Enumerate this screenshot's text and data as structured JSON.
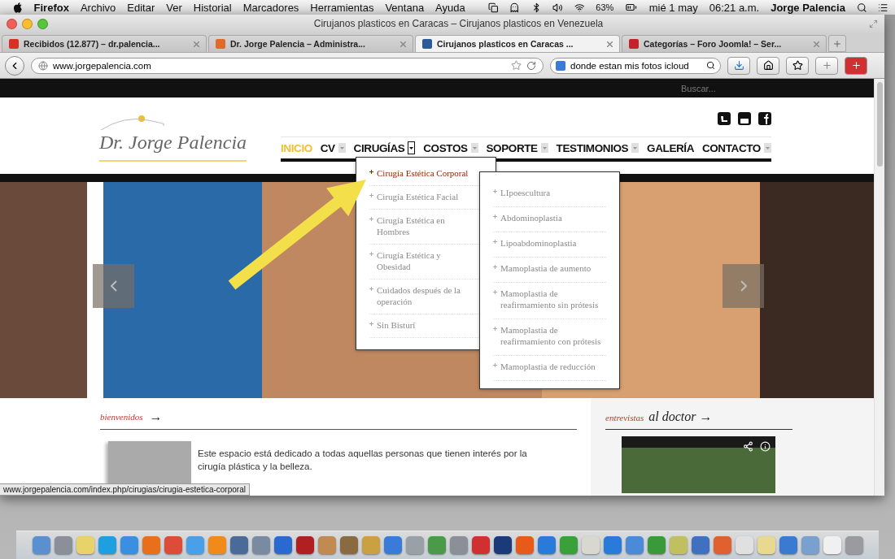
{
  "menubar": {
    "app": "Firefox",
    "menus": [
      "Archivo",
      "Editar",
      "Ver",
      "Historial",
      "Marcadores",
      "Herramientas",
      "Ventana",
      "Ayuda"
    ],
    "battery": "63%",
    "date": "mié 1 may",
    "time": "06:21 a.m.",
    "user": "Jorge Palencia"
  },
  "window": {
    "title": "Cirujanos plasticos en Caracas – Cirujanos plasticos en Venezuela"
  },
  "tabs": [
    {
      "label": "Recibidos (12.877) – dr.palencia...",
      "selected": false,
      "kind": "mail"
    },
    {
      "label": "Dr. Jorge Palencia – Administra...",
      "selected": false,
      "kind": "joomla"
    },
    {
      "label": "Cirujanos plasticos en Caracas ...",
      "selected": true,
      "kind": "site"
    },
    {
      "label": "Categorías – Foro Joomla! – Ser...",
      "selected": false,
      "kind": "forum"
    }
  ],
  "toolbar": {
    "url": "www.jorgepalencia.com",
    "search": "donde estan mis fotos icloud"
  },
  "page": {
    "search_placeholder": "Buscar...",
    "logo": "Dr. Jorge Palencia",
    "nav": [
      {
        "label": "INICIO",
        "selected": true,
        "kind": "plain"
      },
      {
        "label": "CV",
        "selected": false,
        "kind": "dropdown"
      },
      {
        "label": "CIRUGÍAS",
        "selected": false,
        "kind": "open"
      },
      {
        "label": "COSTOS",
        "selected": false,
        "kind": "dropdown"
      },
      {
        "label": "SOPORTE",
        "selected": false,
        "kind": "dropdown"
      },
      {
        "label": "TESTIMONIOS",
        "selected": false,
        "kind": "dropdown"
      },
      {
        "label": "GALERÍA",
        "selected": false,
        "kind": "plain"
      },
      {
        "label": "CONTACTO",
        "selected": false,
        "kind": "dropdown"
      }
    ],
    "dropdown": [
      {
        "label": "Cirugía Estética Corporal",
        "selected": true
      },
      {
        "label": "Cirugía Estética Facial",
        "selected": false
      },
      {
        "label": "Cirugía Estética en Hombres",
        "selected": false
      },
      {
        "label": "Cirugía Estética y Obesidad",
        "selected": false
      },
      {
        "label": "Cuidados después de la operación",
        "selected": false
      },
      {
        "label": "Sin Bisturí",
        "selected": false
      }
    ],
    "submenu": [
      {
        "label": "LIpoescultura",
        "selected": false
      },
      {
        "label": "Abdominoplastia",
        "selected": false
      },
      {
        "label": "Lipoabdominoplastia",
        "selected": false
      },
      {
        "label": "Mamoplastia de aumento",
        "selected": false
      },
      {
        "label": "Mamoplastia de reafirmamiento sin prótesis",
        "selected": false
      },
      {
        "label": "Mamoplastia de reafirmamiento con prótesis",
        "selected": false
      },
      {
        "label": "Mamoplastia de reducción",
        "selected": false
      }
    ],
    "welcome": {
      "heading": "bienvenidos",
      "arrow": "→",
      "text": "Este espacio está dedicado a todas aquellas personas que tienen interés por la cirugía plástica y la belleza."
    },
    "sidebar": {
      "kicker": "entrevistas",
      "heading": "al doctor →"
    }
  },
  "status_url": "www.jorgepalencia.com/index.php/cirugias/cirugia-estetica-corporal",
  "dock": [
    {
      "color": "#5a8fd0"
    },
    {
      "color": "#8a8f99"
    },
    {
      "color": "#e8d36a"
    },
    {
      "color": "#1ea0e0"
    },
    {
      "color": "#3a8fe0"
    },
    {
      "color": "#e8701a"
    },
    {
      "color": "#dd4b39"
    },
    {
      "color": "#4aa0e8"
    },
    {
      "color": "#f08a1a"
    },
    {
      "color": "#4a6a9a"
    },
    {
      "color": "#7a8aa0"
    },
    {
      "color": "#2a6ad0"
    },
    {
      "color": "#b02020"
    },
    {
      "color": "#c08a50"
    },
    {
      "color": "#8a6a40"
    },
    {
      "color": "#caa040"
    },
    {
      "color": "#3a7ad8"
    },
    {
      "color": "#9aa0a8"
    },
    {
      "color": "#4a9a4a"
    },
    {
      "color": "#8a8f98"
    },
    {
      "color": "#d03030"
    },
    {
      "color": "#1a3a7a"
    },
    {
      "color": "#e85a1a"
    },
    {
      "color": "#2a7ad9"
    },
    {
      "color": "#3aa03a"
    },
    {
      "color": "#d8d8d0"
    },
    {
      "color": "#2a7ada"
    },
    {
      "color": "#4a8ad8"
    },
    {
      "color": "#3a9a3b"
    },
    {
      "color": "#c0c060"
    },
    {
      "color": "#4070c0"
    },
    {
      "color": "#e06030"
    },
    {
      "color": "#e0e0e0"
    },
    {
      "color": "#e8d890"
    },
    {
      "color": "#3a7ad0"
    },
    {
      "color": "#7aa0d0"
    },
    {
      "color": "#f0f0f0"
    },
    {
      "color": "#9a9aa0"
    }
  ]
}
